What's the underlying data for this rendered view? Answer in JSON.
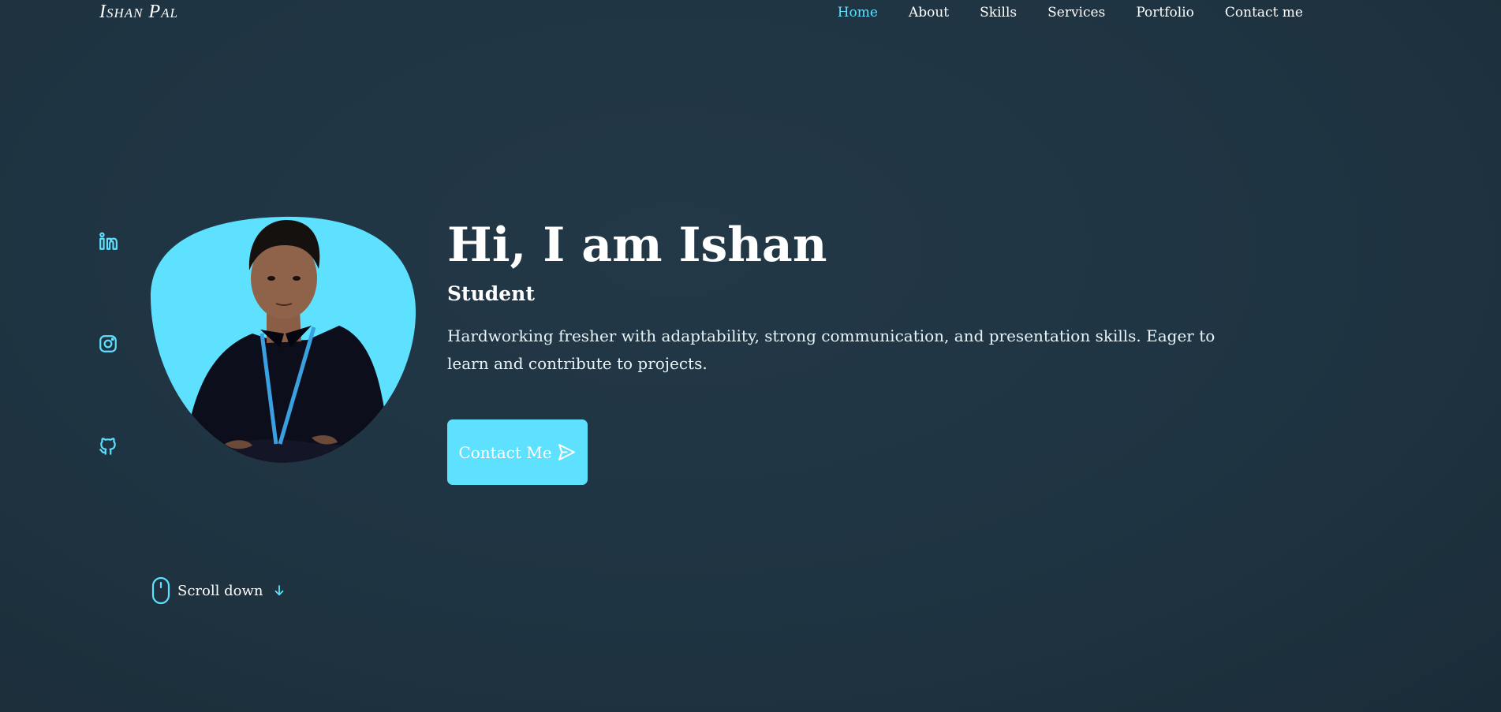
{
  "header": {
    "logo": "Ishan Pal",
    "nav": [
      {
        "label": "Home",
        "active": true
      },
      {
        "label": "About",
        "active": false
      },
      {
        "label": "Skills",
        "active": false
      },
      {
        "label": "Services",
        "active": false
      },
      {
        "label": "Portfolio",
        "active": false
      },
      {
        "label": "Contact me",
        "active": false
      }
    ]
  },
  "social": [
    {
      "icon": "linkedin-icon"
    },
    {
      "icon": "instagram-icon"
    },
    {
      "icon": "github-icon"
    }
  ],
  "hero": {
    "title": "Hi, I am Ishan",
    "subtitle": "Student",
    "description": "Hardworking fresher with adaptability, strong communication, and presentation skills. Eager to learn and contribute to projects.",
    "cta_label": "Contact Me",
    "cta_icon": "send-icon"
  },
  "scroll": {
    "label": "Scroll down",
    "icon": "mouse-icon",
    "arrow_icon": "arrow-down-icon"
  },
  "colors": {
    "accent": "#5ee1ff",
    "background": "#1f3442",
    "text": "#ffffff"
  }
}
